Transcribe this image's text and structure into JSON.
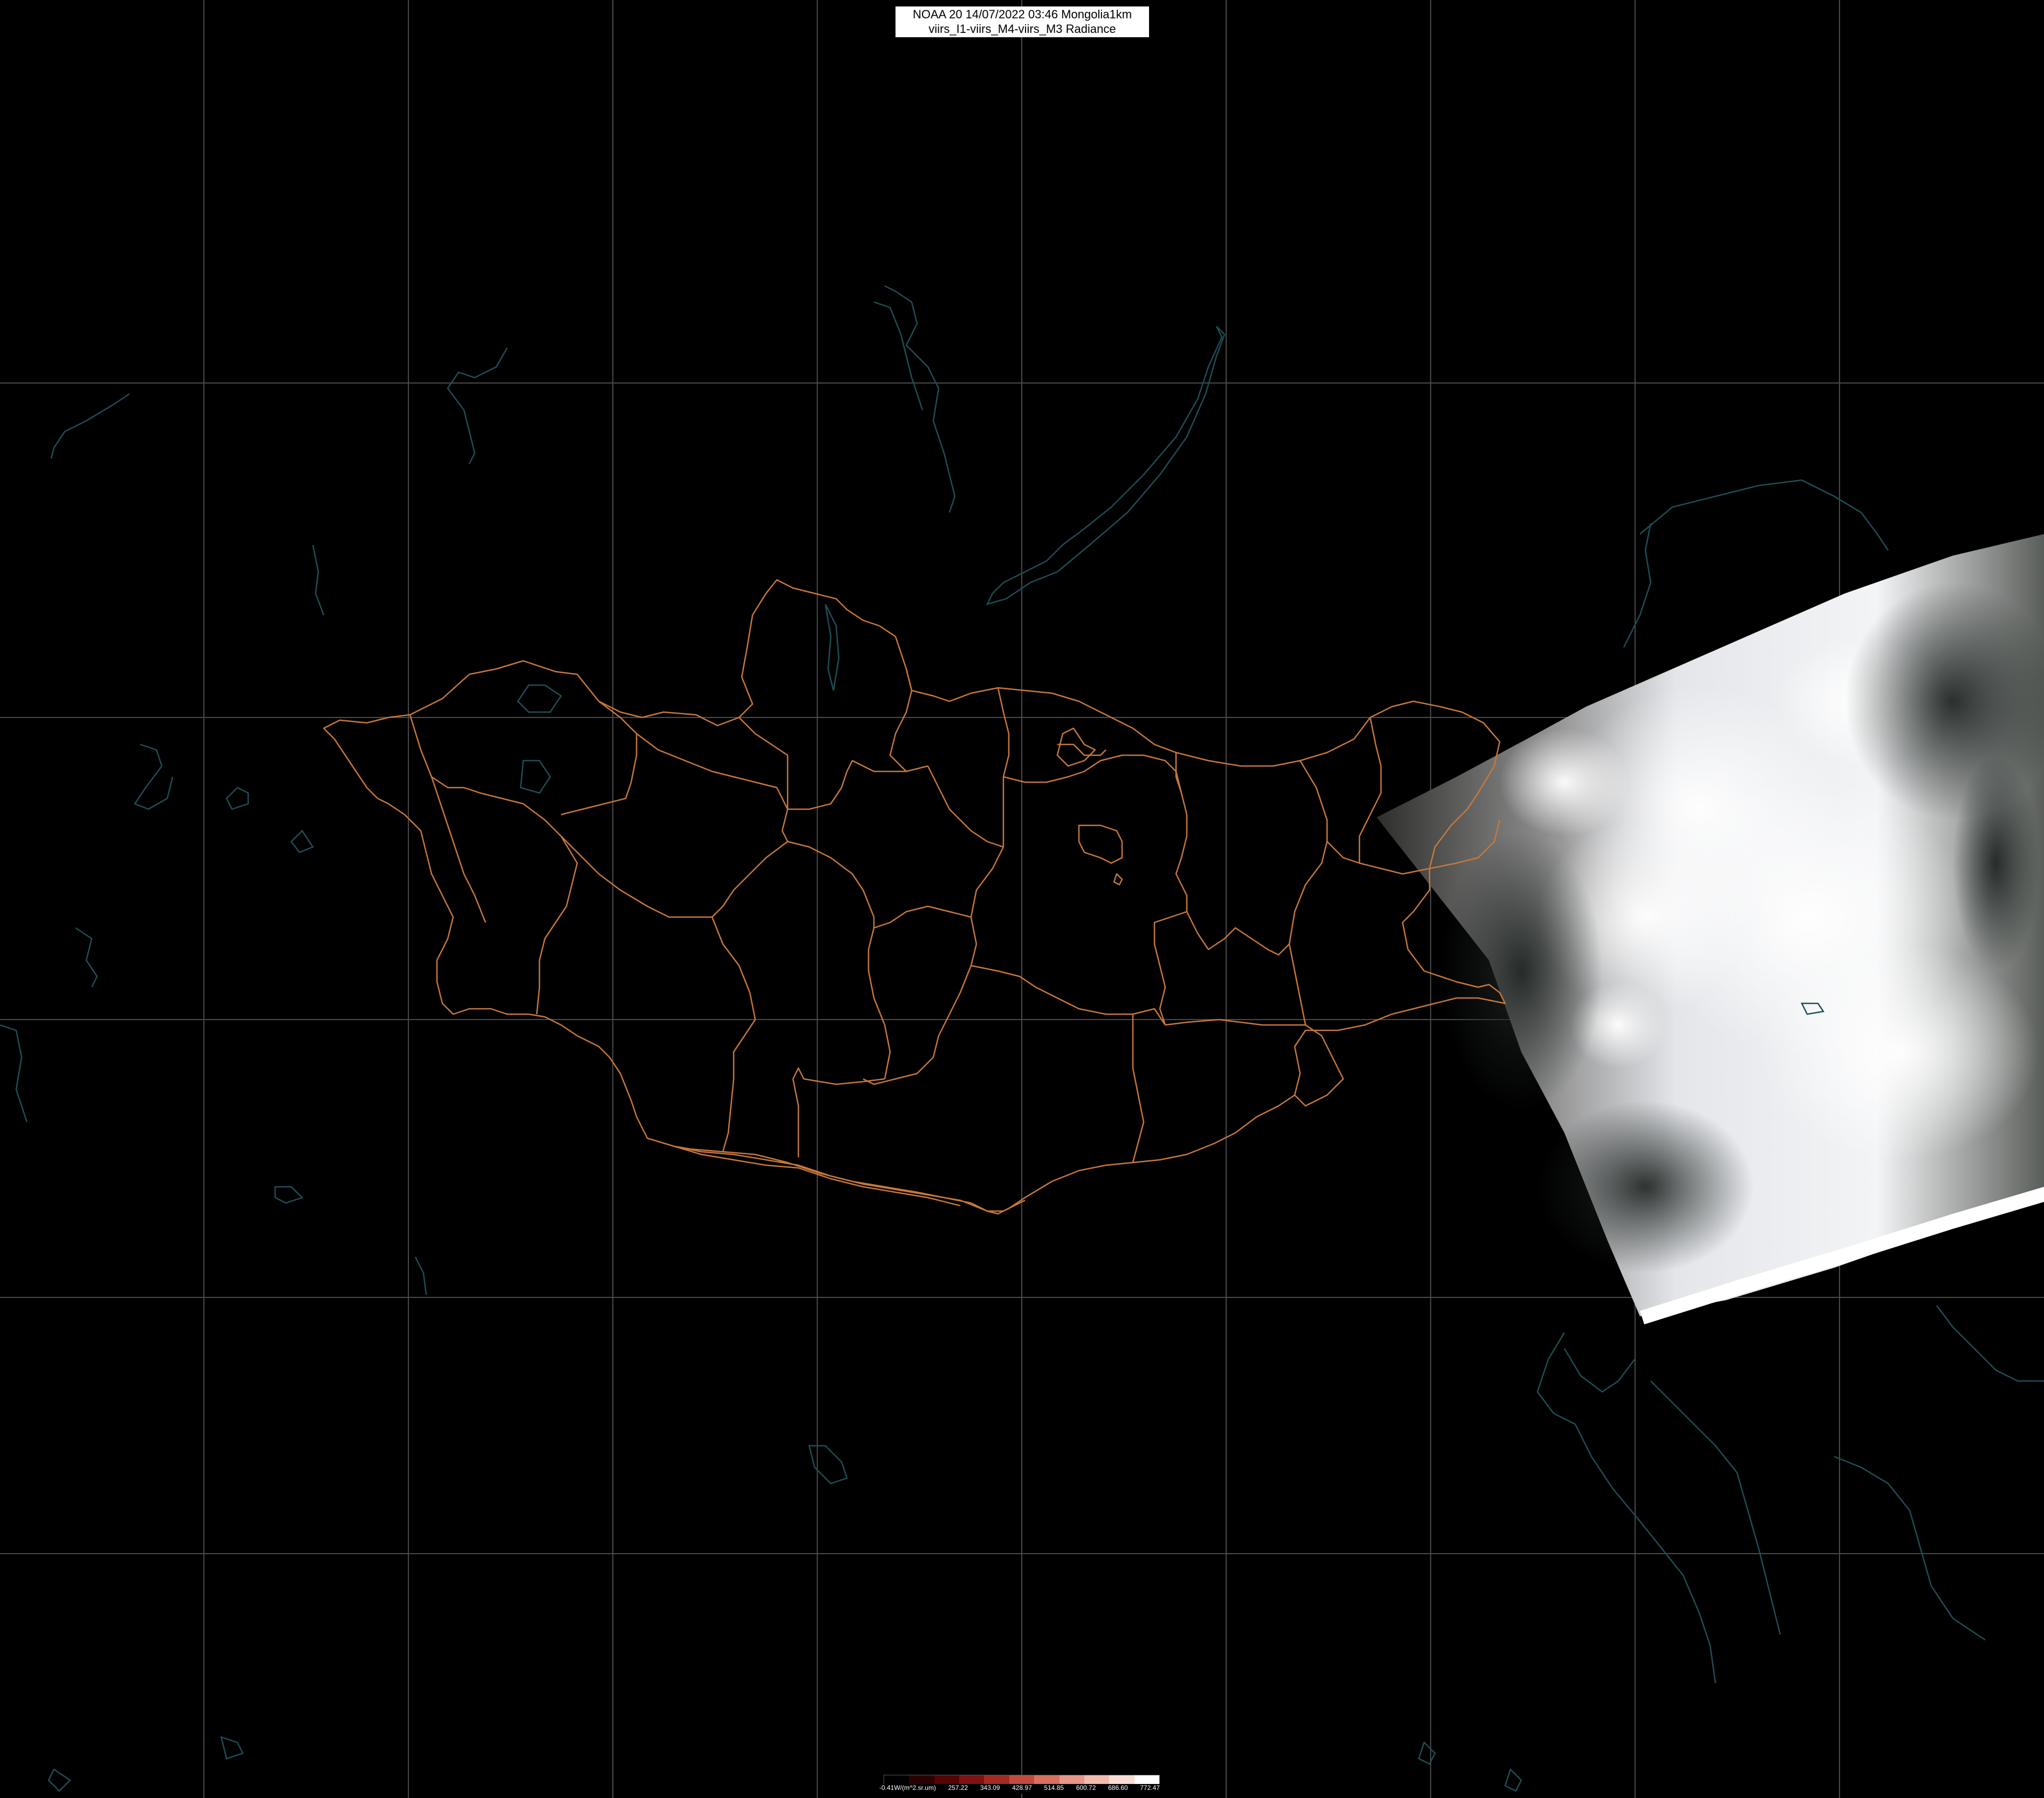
{
  "title": {
    "line1": "NOAA 20 14/07/2022 03:46 Mongolia1km",
    "line2": "viirs_I1-viirs_M4-viirs_M3 Radiance"
  },
  "legend": {
    "labels": [
      "-0.41W/(m^2.sr.um)",
      "257.22",
      "343.09",
      "428.97",
      "514.85",
      "600.72",
      "686.60",
      "772.47"
    ],
    "colors": [
      "#000000",
      "#2a0000",
      "#550404",
      "#7f1212",
      "#a52a22",
      "#c24a3e",
      "#d8705f",
      "#e69785",
      "#f1bbad",
      "#f9dcd3",
      "#ffffff"
    ]
  },
  "map": {
    "background_color": "#000000",
    "grid_color": "#4a4a4a",
    "border_color": "#c8783c",
    "coast_color": "#1f4f57"
  }
}
